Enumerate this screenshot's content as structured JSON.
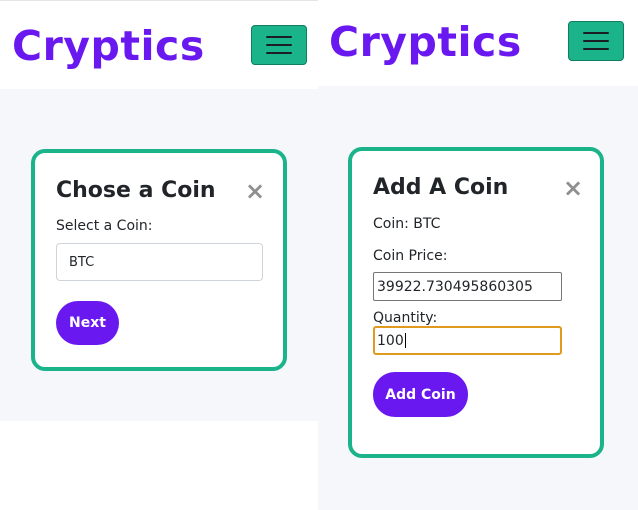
{
  "brand": {
    "name": "Cryptics"
  },
  "icons": {
    "menu": "hamburger-menu-icon",
    "close": "close-icon"
  },
  "colors": {
    "brand": "#6a18f0",
    "accent": "#1bb38a",
    "focus": "#e09b1f"
  },
  "choose_coin": {
    "title": "Chose a Coin",
    "close_glyph": "×",
    "select_label": "Select a Coin:",
    "select_value": "BTC",
    "next_label": "Next"
  },
  "add_coin": {
    "title": "Add A Coin",
    "close_glyph": "×",
    "coin_line": "Coin: BTC",
    "price_label": "Coin Price:",
    "price_value": "39922.730495860305",
    "quantity_label": "Quantity:",
    "quantity_value": "100",
    "submit_label": "Add Coin"
  }
}
